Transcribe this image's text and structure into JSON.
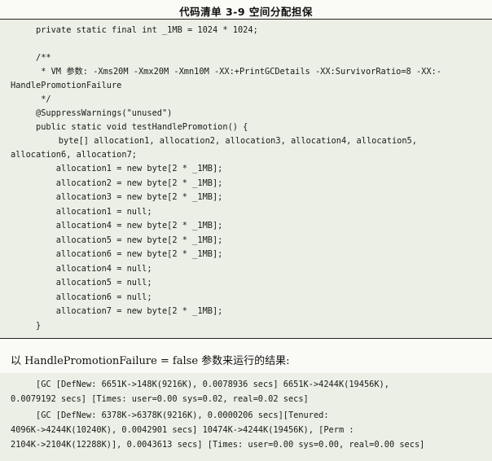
{
  "caption": "代码清单 3-9    空间分配担保",
  "code_lines": [
    "private static final int _1MB = 1024 * 1024;",
    "",
    "/**",
    " * VM 参数: -Xms20M -Xmx20M -Xmn10M -XX:+PrintGCDetails -XX:SurvivorRatio=8 -XX:-",
    "HandlePromotionFailure",
    " */",
    "@SuppressWarnings(\"unused\")",
    "public static void testHandlePromotion() {",
    "    byte[] allocation1, allocation2, allocation3, allocation4, allocation5,",
    "allocation6, allocation7;",
    "    allocation1 = new byte[2 * _1MB];",
    "    allocation2 = new byte[2 * _1MB];",
    "    allocation3 = new byte[2 * _1MB];",
    "    allocation1 = null;",
    "    allocation4 = new byte[2 * _1MB];",
    "    allocation5 = new byte[2 * _1MB];",
    "    allocation6 = new byte[2 * _1MB];",
    "    allocation4 = null;",
    "    allocation5 = null;",
    "    allocation6 = null;",
    "    allocation7 = new byte[2 * _1MB];",
    "}"
  ],
  "note": "以 HandlePromotionFailure = false 参数来运行的结果:",
  "output_lines": [
    "[GC [DefNew: 6651K->148K(9216K), 0.0078936 secs] 6651K->4244K(19456K),",
    "0.0079192 secs] [Times: user=0.00 sys=0.02, real=0.02 secs]",
    "[GC [DefNew: 6378K->6378K(9216K), 0.0000206 secs][Tenured:",
    "4096K->4244K(10240K), 0.0042901 secs] 10474K->4244K(19456K), [Perm :",
    "2104K->2104K(12288K)], 0.0043613 secs] [Times: user=0.00 sys=0.00, real=0.00 secs]"
  ]
}
